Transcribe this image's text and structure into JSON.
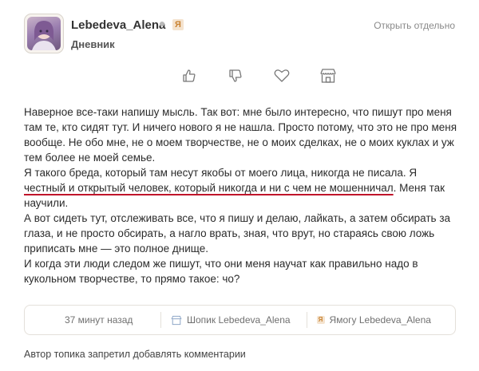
{
  "post_header": {
    "author": "Lebedeva_Alena",
    "badge": "Я",
    "section": "Дневник",
    "open_separately": "Открыть отдельно"
  },
  "actions": [
    {
      "name": "like",
      "icon": "thumbs-up-icon"
    },
    {
      "name": "dislike",
      "icon": "thumbs-down-icon"
    },
    {
      "name": "favorite",
      "icon": "heart-icon"
    },
    {
      "name": "shop",
      "icon": "shop-icon"
    }
  ],
  "body": {
    "p1": "Наверное все-таки напишу мысль. Так вот: мне было интересно, что пишут про меня там те, кто сидят тут. И ничего нового я не нашла. Просто потому, что это не про меня вообще. Не обо мне, не о моем творчестве, не о моих сделках, не о моих куклах и уж тем более не моей семье.",
    "p2_before": "Я такого бреда, который там несут якобы от моего лица, никогда не писала. Я ",
    "p2_under": "честный и открытый человек, который никогда и ни с чем не мошенничал",
    "p2_after": ". Меня так научили.",
    "p3": "А вот сидеть тут, отслеживать все, что я пишу и делаю, лайкать, а затем обсирать за глаза, и не просто обсирать, а нагло врать, зная, что врут, но стараясь свою ложь приписать мне — это полное днище.",
    "p4": "И когда эти люди следом же пишут, что они меня научат как правильно надо в кукольном творчестве, то прямо такое: чо?"
  },
  "footer": {
    "time": "37 минут назад",
    "shop_link": "Шопик Lebedeva_Alena",
    "yamogu_link": "Ямогу Lebedeva_Alena"
  },
  "comments_disabled": "Автор топика запретил добавлять комментарии",
  "colors": {
    "accent_underline": "#c0142a",
    "badge_bg": "#f4e3cf",
    "badge_fg": "#c98332"
  }
}
